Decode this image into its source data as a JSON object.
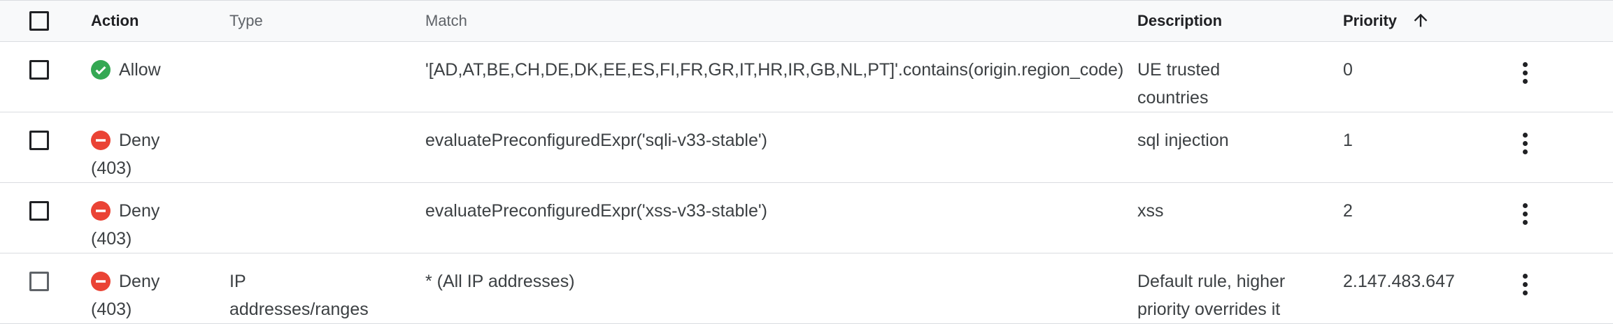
{
  "columns": {
    "action": "Action",
    "type": "Type",
    "match": "Match",
    "description": "Description",
    "priority": "Priority"
  },
  "sort": {
    "column": "priority",
    "direction": "ascending",
    "icon": "arrow-up-icon"
  },
  "colors": {
    "allow": "#34a853",
    "deny": "#ea4335",
    "border": "#dadce0",
    "header_bg": "#f8f9fa"
  },
  "rules": [
    {
      "action_label": "Allow",
      "action_icon": "check-circle-icon",
      "action_code": "",
      "type": "",
      "match": "'[AD,AT,BE,CH,DE,DK,EE,ES,FI,FR,GR,IT,HR,IR,GB,NL,PT]'.contains(origin.region_code)",
      "description_1": "UE trusted",
      "description_2": "countries",
      "priority": "0"
    },
    {
      "action_label": "Deny",
      "action_icon": "minus-circle-icon",
      "action_code": "(403)",
      "type": "",
      "match": "evaluatePreconfiguredExpr('sqli-v33-stable')",
      "description_1": "sql injection",
      "description_2": "",
      "priority": "1"
    },
    {
      "action_label": "Deny",
      "action_icon": "minus-circle-icon",
      "action_code": "(403)",
      "type": "",
      "match": "evaluatePreconfiguredExpr('xss-v33-stable')",
      "description_1": "xss",
      "description_2": "",
      "priority": "2"
    },
    {
      "action_label": "Deny",
      "action_icon": "minus-circle-icon",
      "action_code": "(403)",
      "type_1": "IP",
      "type_2": "addresses/ranges",
      "match": "* (All IP addresses)",
      "description_1": "Default rule, higher",
      "description_2": "priority overrides it",
      "priority": "2.147.483.647"
    }
  ]
}
